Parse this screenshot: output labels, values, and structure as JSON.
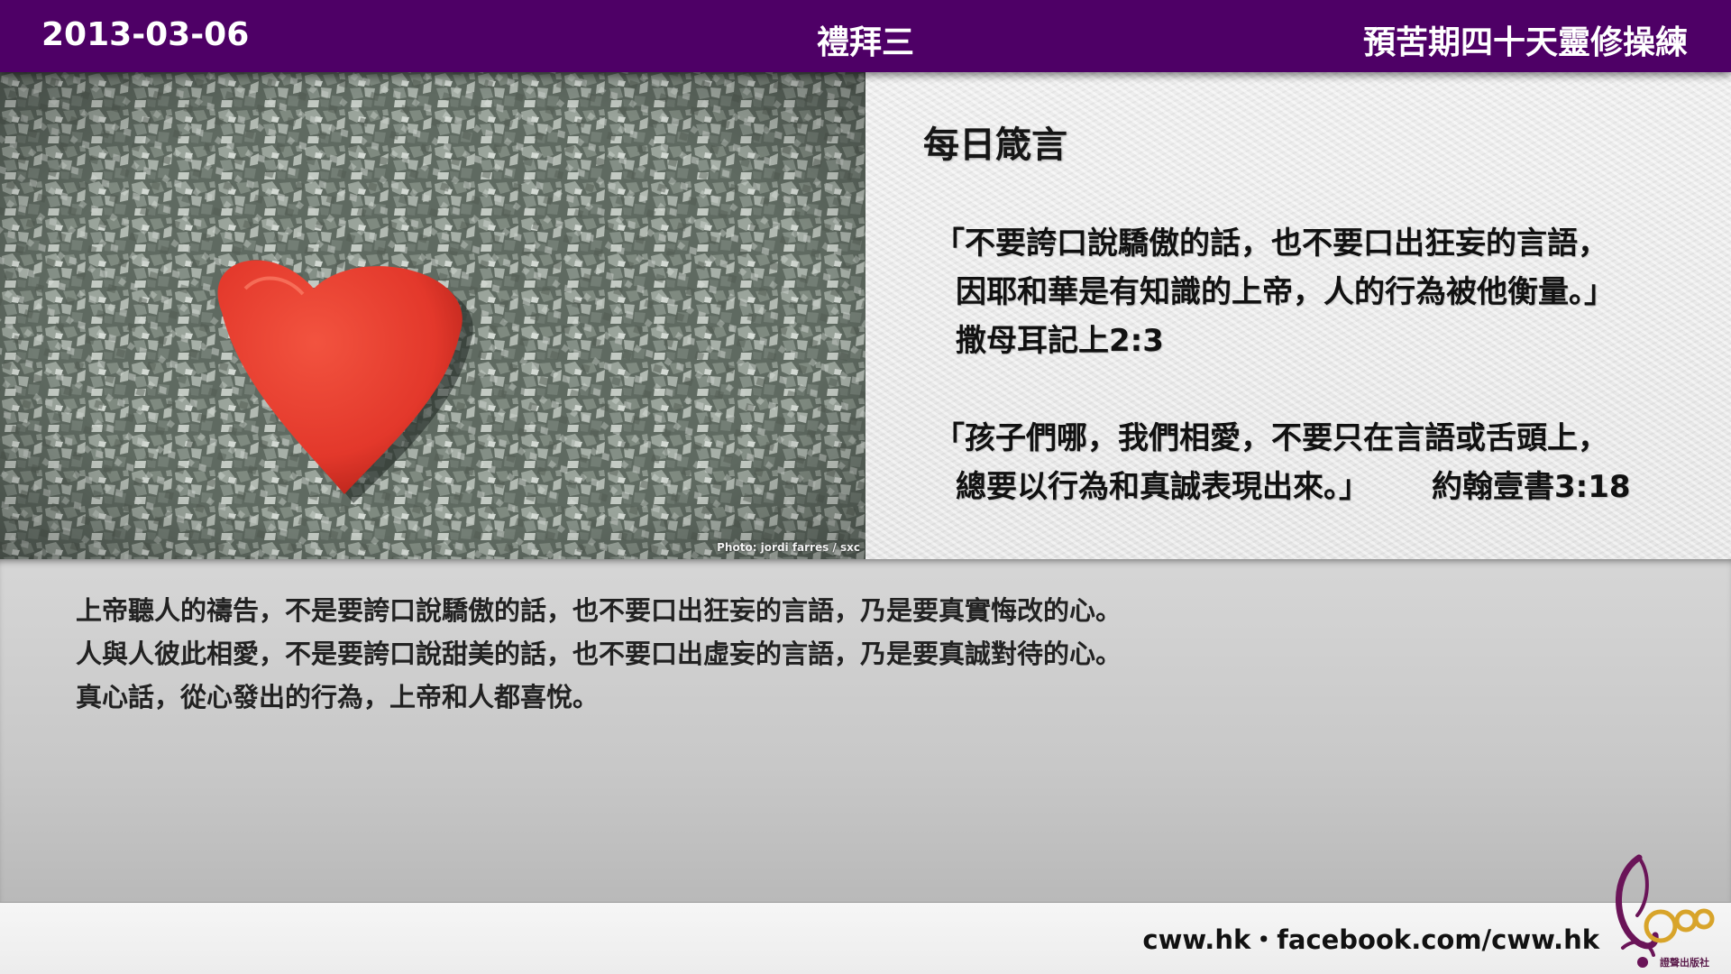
{
  "header": {
    "date": "2013-03-06",
    "day": "禮拜三",
    "series": "預苦期四十天靈修操練"
  },
  "photo": {
    "credit": "Photo: jordi farres / sxc",
    "colors": {
      "stones": "#7d877e",
      "heart": "#e8372c"
    }
  },
  "verse_panel": {
    "title": "每日箴言",
    "verse1": {
      "line1": "「不要誇口說驕傲的話，也不要口出狂妄的言語，",
      "line2": "因耶和華是有知識的上帝，人的行為被他衡量。」",
      "ref": "撒母耳記上2:3"
    },
    "verse2": {
      "line1": "「孩子們哪，我們相愛，不要只在言語或舌頭上，",
      "line2": "總要以行為和真誠表現出來。」",
      "ref": "約翰壹書3:18"
    }
  },
  "reflection": {
    "lines": [
      "上帝聽人的禱告，不是要誇口說驕傲的話，也不要口出狂妄的言語，乃是要真實悔改的心。",
      "人與人彼此相愛，不是要誇口說甜美的話，也不要口出虛妄的言語，乃是要真誠對待的心。",
      "真心話，從心發出的行為，上帝和人都喜悅。"
    ]
  },
  "footer": {
    "links": "cww.hk・facebook.com/cww.hk",
    "logo_text": "100",
    "publisher": "證聲出版社"
  },
  "colors": {
    "header_bg": "#4e0066",
    "logo_purple": "#6a1458",
    "logo_gold": "#d8a42a"
  }
}
